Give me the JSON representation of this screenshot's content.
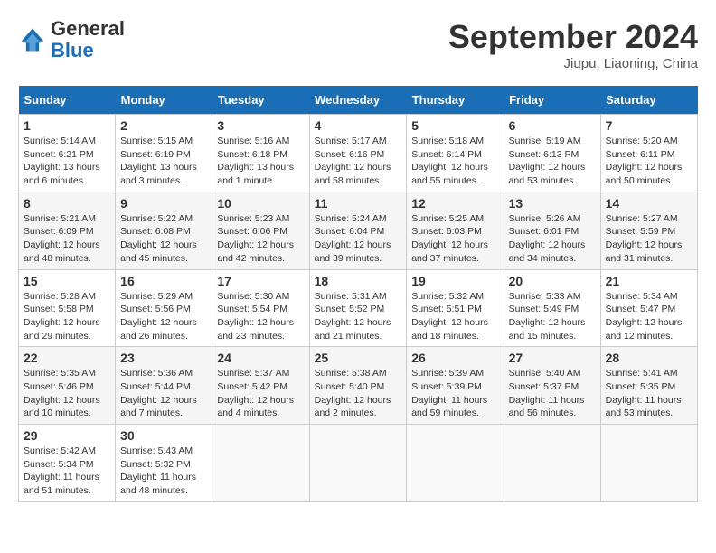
{
  "header": {
    "logo_general": "General",
    "logo_blue": "Blue",
    "month_title": "September 2024",
    "location": "Jiupu, Liaoning, China"
  },
  "days_of_week": [
    "Sunday",
    "Monday",
    "Tuesday",
    "Wednesday",
    "Thursday",
    "Friday",
    "Saturday"
  ],
  "weeks": [
    [
      {
        "day": "1",
        "info": "Sunrise: 5:14 AM\nSunset: 6:21 PM\nDaylight: 13 hours\nand 6 minutes."
      },
      {
        "day": "2",
        "info": "Sunrise: 5:15 AM\nSunset: 6:19 PM\nDaylight: 13 hours\nand 3 minutes."
      },
      {
        "day": "3",
        "info": "Sunrise: 5:16 AM\nSunset: 6:18 PM\nDaylight: 13 hours\nand 1 minute."
      },
      {
        "day": "4",
        "info": "Sunrise: 5:17 AM\nSunset: 6:16 PM\nDaylight: 12 hours\nand 58 minutes."
      },
      {
        "day": "5",
        "info": "Sunrise: 5:18 AM\nSunset: 6:14 PM\nDaylight: 12 hours\nand 55 minutes."
      },
      {
        "day": "6",
        "info": "Sunrise: 5:19 AM\nSunset: 6:13 PM\nDaylight: 12 hours\nand 53 minutes."
      },
      {
        "day": "7",
        "info": "Sunrise: 5:20 AM\nSunset: 6:11 PM\nDaylight: 12 hours\nand 50 minutes."
      }
    ],
    [
      {
        "day": "8",
        "info": "Sunrise: 5:21 AM\nSunset: 6:09 PM\nDaylight: 12 hours\nand 48 minutes."
      },
      {
        "day": "9",
        "info": "Sunrise: 5:22 AM\nSunset: 6:08 PM\nDaylight: 12 hours\nand 45 minutes."
      },
      {
        "day": "10",
        "info": "Sunrise: 5:23 AM\nSunset: 6:06 PM\nDaylight: 12 hours\nand 42 minutes."
      },
      {
        "day": "11",
        "info": "Sunrise: 5:24 AM\nSunset: 6:04 PM\nDaylight: 12 hours\nand 39 minutes."
      },
      {
        "day": "12",
        "info": "Sunrise: 5:25 AM\nSunset: 6:03 PM\nDaylight: 12 hours\nand 37 minutes."
      },
      {
        "day": "13",
        "info": "Sunrise: 5:26 AM\nSunset: 6:01 PM\nDaylight: 12 hours\nand 34 minutes."
      },
      {
        "day": "14",
        "info": "Sunrise: 5:27 AM\nSunset: 5:59 PM\nDaylight: 12 hours\nand 31 minutes."
      }
    ],
    [
      {
        "day": "15",
        "info": "Sunrise: 5:28 AM\nSunset: 5:58 PM\nDaylight: 12 hours\nand 29 minutes."
      },
      {
        "day": "16",
        "info": "Sunrise: 5:29 AM\nSunset: 5:56 PM\nDaylight: 12 hours\nand 26 minutes."
      },
      {
        "day": "17",
        "info": "Sunrise: 5:30 AM\nSunset: 5:54 PM\nDaylight: 12 hours\nand 23 minutes."
      },
      {
        "day": "18",
        "info": "Sunrise: 5:31 AM\nSunset: 5:52 PM\nDaylight: 12 hours\nand 21 minutes."
      },
      {
        "day": "19",
        "info": "Sunrise: 5:32 AM\nSunset: 5:51 PM\nDaylight: 12 hours\nand 18 minutes."
      },
      {
        "day": "20",
        "info": "Sunrise: 5:33 AM\nSunset: 5:49 PM\nDaylight: 12 hours\nand 15 minutes."
      },
      {
        "day": "21",
        "info": "Sunrise: 5:34 AM\nSunset: 5:47 PM\nDaylight: 12 hours\nand 12 minutes."
      }
    ],
    [
      {
        "day": "22",
        "info": "Sunrise: 5:35 AM\nSunset: 5:46 PM\nDaylight: 12 hours\nand 10 minutes."
      },
      {
        "day": "23",
        "info": "Sunrise: 5:36 AM\nSunset: 5:44 PM\nDaylight: 12 hours\nand 7 minutes."
      },
      {
        "day": "24",
        "info": "Sunrise: 5:37 AM\nSunset: 5:42 PM\nDaylight: 12 hours\nand 4 minutes."
      },
      {
        "day": "25",
        "info": "Sunrise: 5:38 AM\nSunset: 5:40 PM\nDaylight: 12 hours\nand 2 minutes."
      },
      {
        "day": "26",
        "info": "Sunrise: 5:39 AM\nSunset: 5:39 PM\nDaylight: 11 hours\nand 59 minutes."
      },
      {
        "day": "27",
        "info": "Sunrise: 5:40 AM\nSunset: 5:37 PM\nDaylight: 11 hours\nand 56 minutes."
      },
      {
        "day": "28",
        "info": "Sunrise: 5:41 AM\nSunset: 5:35 PM\nDaylight: 11 hours\nand 53 minutes."
      }
    ],
    [
      {
        "day": "29",
        "info": "Sunrise: 5:42 AM\nSunset: 5:34 PM\nDaylight: 11 hours\nand 51 minutes."
      },
      {
        "day": "30",
        "info": "Sunrise: 5:43 AM\nSunset: 5:32 PM\nDaylight: 11 hours\nand 48 minutes."
      },
      {
        "day": "",
        "info": ""
      },
      {
        "day": "",
        "info": ""
      },
      {
        "day": "",
        "info": ""
      },
      {
        "day": "",
        "info": ""
      },
      {
        "day": "",
        "info": ""
      }
    ]
  ]
}
